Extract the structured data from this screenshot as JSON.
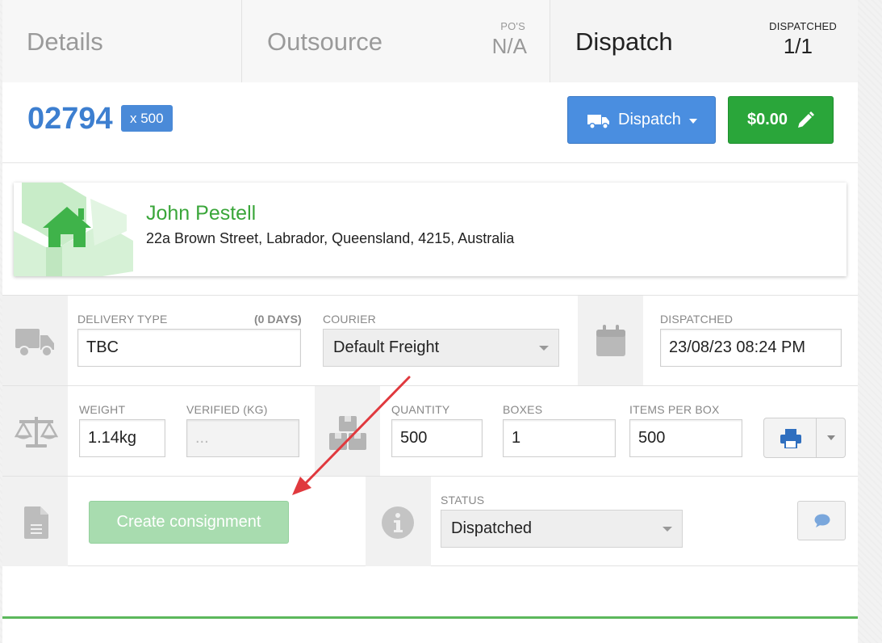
{
  "tabs": {
    "details": {
      "title": "Details"
    },
    "outsource": {
      "title": "Outsource",
      "meta_label": "PO'S",
      "meta_value": "N/A"
    },
    "dispatch": {
      "title": "Dispatch",
      "meta_label": "DISPATCHED",
      "meta_value": "1/1"
    }
  },
  "header": {
    "job_number": "02794",
    "quantity_badge": "x 500",
    "dispatch_button": "Dispatch",
    "price_button": "$0.00"
  },
  "address": {
    "name": "John Pestell",
    "line": "22a Brown Street, Labrador, Queensland, 4215, Australia"
  },
  "delivery": {
    "delivery_type_label": "DELIVERY TYPE",
    "delivery_type_hint": "(0 DAYS)",
    "delivery_type_value": "TBC",
    "courier_label": "COURIER",
    "courier_value": "Default Freight",
    "dispatched_label": "DISPATCHED",
    "dispatched_value": "23/08/23 08:24 PM"
  },
  "measurements": {
    "weight_label": "WEIGHT",
    "weight_value": "1.14kg",
    "verified_label": "VERIFIED (KG)",
    "verified_placeholder": "...",
    "quantity_label": "QUANTITY",
    "quantity_value": "500",
    "boxes_label": "BOXES",
    "boxes_value": "1",
    "items_per_box_label": "ITEMS PER BOX",
    "items_per_box_value": "500"
  },
  "consignment": {
    "create_button": "Create consignment",
    "status_label": "STATUS",
    "status_value": "Dispatched"
  },
  "colors": {
    "primary": "#4a8ee0",
    "success": "#2aa63a",
    "job_number": "#3d7fd0",
    "annotation_arrow": "#e0393e"
  }
}
